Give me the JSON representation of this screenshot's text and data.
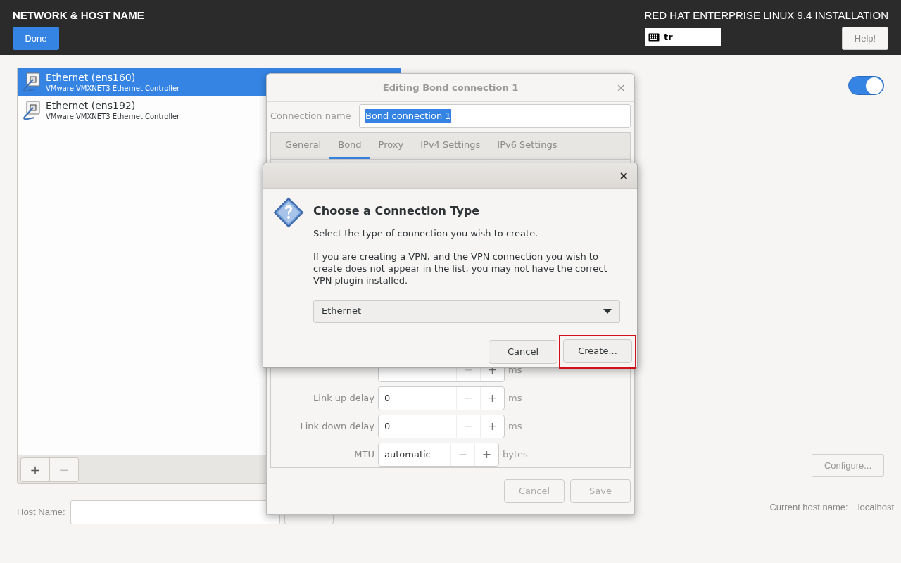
{
  "header": {
    "title": "NETWORK & HOST NAME",
    "done_button": "Done",
    "product": "RED HAT ENTERPRISE LINUX 9.4 INSTALLATION",
    "keyboard_layout": "tr",
    "help_button": "Help!"
  },
  "devices": [
    {
      "name": "Ethernet (ens160)",
      "description": "VMware VMXNET3 Ethernet Controller",
      "selected": true
    },
    {
      "name": "Ethernet (ens192)",
      "description": "VMware VMXNET3 Ethernet Controller",
      "selected": false
    }
  ],
  "list_toolbar": {
    "add": "+",
    "remove": "−"
  },
  "device_switch": {
    "on": true
  },
  "configure_button": "Configure...",
  "host_name": {
    "label": "Host Name:",
    "current_label": "Current host name:",
    "current_value": "localhost"
  },
  "editing_dialog": {
    "title": "Editing Bond connection 1",
    "close": "×",
    "connection_name_label": "Connection name",
    "connection_name_value": "Bond connection 1",
    "tabs": [
      {
        "label": "General",
        "selected": false
      },
      {
        "label": "Bond",
        "selected": true
      },
      {
        "label": "Proxy",
        "selected": false
      },
      {
        "label": "IPv4 Settings",
        "selected": false
      },
      {
        "label": "IPv6 Settings",
        "selected": false
      }
    ],
    "rows": [
      {
        "minus": "−",
        "plus": "+",
        "unit": "ms"
      },
      {
        "label": "Link up delay",
        "value": "0",
        "minus": "−",
        "plus": "+",
        "unit": "ms"
      },
      {
        "label": "Link down delay",
        "value": "0",
        "minus": "−",
        "plus": "+",
        "unit": "ms"
      },
      {
        "label": "MTU",
        "value": "automatic",
        "minus": "−",
        "plus": "+",
        "unit": "bytes"
      }
    ],
    "buttons": [
      {
        "label": "Cancel"
      },
      {
        "label": "Save"
      }
    ]
  },
  "type_dialog": {
    "close": "×",
    "title": "Choose a Connection Type",
    "text": "Select the type of connection you wish to create.",
    "note": "If you are creating a VPN, and the VPN connection you wish to create does not appear in the list, you may not have the correct VPN plugin installed.",
    "dropdown": "Ethernet",
    "buttons": [
      {
        "label": "Cancel",
        "highlighted": false
      },
      {
        "label": "Create...",
        "highlighted": true
      }
    ]
  }
}
